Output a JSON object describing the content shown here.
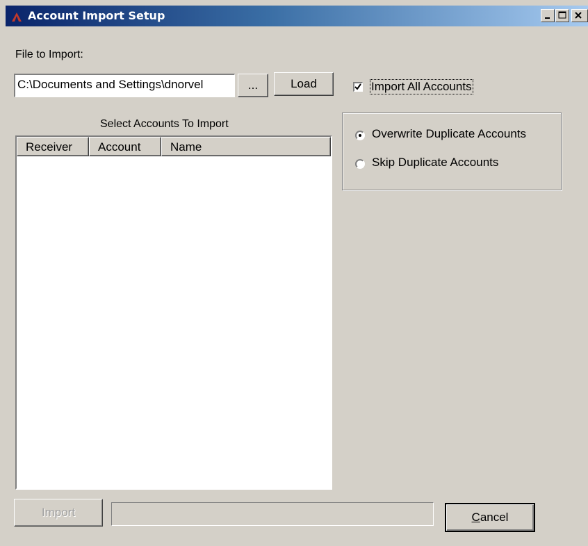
{
  "window": {
    "title": "Account Import Setup",
    "app_icon": "app-logo-icon",
    "controls": [
      "minimize-icon",
      "maximize-icon",
      "close-icon"
    ]
  },
  "file": {
    "label": "File to Import:",
    "path_value": "C:\\Documents and Settings\\dnorvel",
    "browse_label": "...",
    "load_label": "Load"
  },
  "import_all": {
    "label": "Import All Accounts",
    "checked": true
  },
  "accounts": {
    "heading": "Select Accounts To Import",
    "columns": [
      "Receiver",
      "Account",
      "Name"
    ],
    "rows": []
  },
  "duplicates": {
    "options": [
      {
        "label": "Overwrite Duplicate Accounts",
        "selected": true
      },
      {
        "label": "Skip Duplicate Accounts",
        "selected": false
      }
    ]
  },
  "footer": {
    "import_label": "Import",
    "import_enabled": false,
    "progress": 0,
    "cancel_label_prefix": "C",
    "cancel_label_rest": "ancel"
  }
}
